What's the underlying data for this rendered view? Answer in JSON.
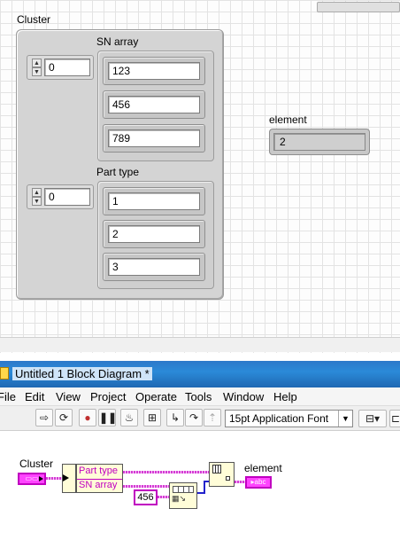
{
  "front_panel": {
    "cluster_label": "Cluster",
    "sn_array_label": "SN array",
    "sn_index": "0",
    "sn_values": [
      "123",
      "456",
      "789"
    ],
    "part_type_label": "Part type",
    "part_index": "0",
    "part_values": [
      "1",
      "2",
      "3"
    ],
    "element_label": "element",
    "element_value": "2"
  },
  "window": {
    "title": "Untitled 1 Block Diagram *"
  },
  "menu": {
    "items": [
      "File",
      "Edit",
      "View",
      "Project",
      "Operate",
      "Tools",
      "Window",
      "Help"
    ]
  },
  "toolbar": {
    "font_select": "15pt Application Font"
  },
  "block_diagram": {
    "cluster_label": "Cluster",
    "cluster_terminal": "▭▭",
    "unbundle_items": [
      "Part type",
      "SN array"
    ],
    "constant_value": "456",
    "element_label": "element",
    "element_terminal": "▸abc"
  }
}
